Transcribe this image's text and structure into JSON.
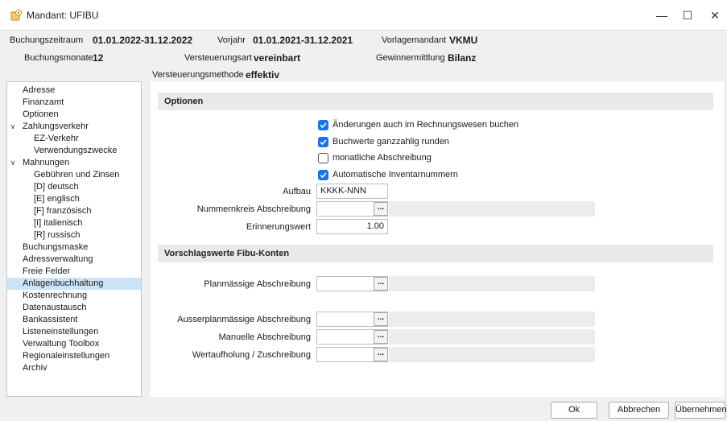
{
  "window": {
    "title": "Mandant: UFIBU",
    "icon": "client-icon",
    "controls": [
      "—",
      "☐",
      "✕"
    ]
  },
  "header": {
    "buchungszeitraum_label": "Buchungszeitraum",
    "buchungszeitraum_value": "01.01.2022-31.12.2022",
    "vorjahr_label": "Vorjahr",
    "vorjahr_value": "01.01.2021-31.12.2021",
    "vorlagemandant_label": "Vorlagemandant",
    "vorlagemandant_value": "VKMU",
    "buchungsmonate_label": "Buchungsmonate",
    "buchungsmonate_value": "12",
    "versteuerungsart_label": "Versteuerungsart",
    "versteuerungsart_value": "vereinbart",
    "gewinnermittlung_label": "Gewinnermittlung",
    "gewinnermittlung_value": "Bilanz",
    "versteuerungsmethode_label": "Versteuerungsmethode",
    "versteuerungsmethode_value": "effektiv"
  },
  "nav": {
    "items": [
      {
        "label": "Adresse",
        "level": 0
      },
      {
        "label": "Finanzamt",
        "level": 0
      },
      {
        "label": "Optionen",
        "level": 0
      },
      {
        "label": "Zahlungsverkehr",
        "level": 0,
        "expanded": true
      },
      {
        "label": "EZ-Verkehr",
        "level": 1
      },
      {
        "label": "Verwendungszwecke",
        "level": 1
      },
      {
        "label": "Mahnungen",
        "level": 0,
        "expanded": true
      },
      {
        "label": "Gebühren und Zinsen",
        "level": 1
      },
      {
        "label": "[D] deutsch",
        "level": 1
      },
      {
        "label": "[E] englisch",
        "level": 1
      },
      {
        "label": "[F] französisch",
        "level": 1
      },
      {
        "label": "[I] italienisch",
        "level": 1
      },
      {
        "label": "[R] russisch",
        "level": 1
      },
      {
        "label": "Buchungsmaske",
        "level": 0
      },
      {
        "label": "Adressverwaltung",
        "level": 0
      },
      {
        "label": "Freie Felder",
        "level": 0
      },
      {
        "label": "Anlagenbuchhaltung",
        "level": 0,
        "selected": true
      },
      {
        "label": "Kostenrechnung",
        "level": 0
      },
      {
        "label": "Datenaustausch",
        "level": 0
      },
      {
        "label": "Bankassistent",
        "level": 0
      },
      {
        "label": "Listeneinstellungen",
        "level": 0
      },
      {
        "label": "Verwaltung Toolbox",
        "level": 0
      },
      {
        "label": "Regionaleinstellungen",
        "level": 0
      },
      {
        "label": "Archiv",
        "level": 0
      }
    ]
  },
  "optionen": {
    "title": "Optionen",
    "checkboxes": [
      {
        "label": "Änderungen auch im Rechnungswesen buchen",
        "checked": true
      },
      {
        "label": "Buchwerte ganzzahlig runden",
        "checked": true
      },
      {
        "label": "monatliche Abschreibung",
        "checked": false
      },
      {
        "label": "Automatische Inventarnummern",
        "checked": true
      }
    ],
    "aufbau_label": "Aufbau",
    "aufbau_value": "KKKK-NNN",
    "nummernkreis_label": "Nummernkreis Abschreibung",
    "nummernkreis_value": "",
    "erinnerungswert_label": "Erinnerungswert",
    "erinnerungswert_value": "1.00"
  },
  "vorschlag": {
    "title": "Vorschlagswerte Fibu-Konten",
    "planmaessige_label": "Planmässige Abschreibung",
    "ausserplanmaessige_label": "Ausserplanmässige Abschreibung",
    "manuelle_label": "Manuelle Abschreibung",
    "wertaufholung_label": "Wertaufholung / Zuschreibung",
    "browse_label": "..."
  },
  "buttons": {
    "ok": "Ok",
    "abbrechen": "Abbrechen",
    "uebernehmen": "Übernehmen"
  },
  "colors": {
    "accent": "#1a73e8",
    "selection": "#cce4f7"
  }
}
